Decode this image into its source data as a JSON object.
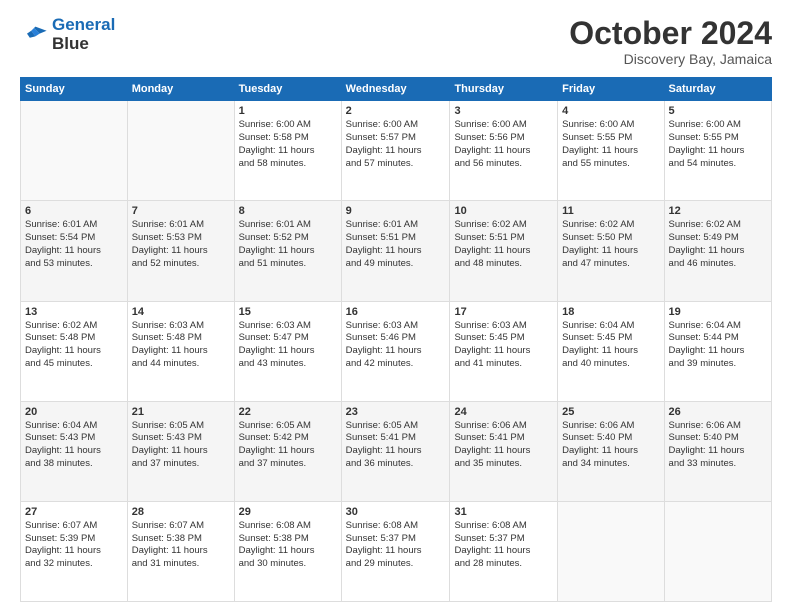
{
  "header": {
    "logo_line1": "General",
    "logo_line2": "Blue",
    "month_title": "October 2024",
    "location": "Discovery Bay, Jamaica"
  },
  "weekdays": [
    "Sunday",
    "Monday",
    "Tuesday",
    "Wednesday",
    "Thursday",
    "Friday",
    "Saturday"
  ],
  "weeks": [
    [
      {
        "day": "",
        "info": ""
      },
      {
        "day": "",
        "info": ""
      },
      {
        "day": "1",
        "info": "Sunrise: 6:00 AM\nSunset: 5:58 PM\nDaylight: 11 hours\nand 58 minutes."
      },
      {
        "day": "2",
        "info": "Sunrise: 6:00 AM\nSunset: 5:57 PM\nDaylight: 11 hours\nand 57 minutes."
      },
      {
        "day": "3",
        "info": "Sunrise: 6:00 AM\nSunset: 5:56 PM\nDaylight: 11 hours\nand 56 minutes."
      },
      {
        "day": "4",
        "info": "Sunrise: 6:00 AM\nSunset: 5:55 PM\nDaylight: 11 hours\nand 55 minutes."
      },
      {
        "day": "5",
        "info": "Sunrise: 6:00 AM\nSunset: 5:55 PM\nDaylight: 11 hours\nand 54 minutes."
      }
    ],
    [
      {
        "day": "6",
        "info": "Sunrise: 6:01 AM\nSunset: 5:54 PM\nDaylight: 11 hours\nand 53 minutes."
      },
      {
        "day": "7",
        "info": "Sunrise: 6:01 AM\nSunset: 5:53 PM\nDaylight: 11 hours\nand 52 minutes."
      },
      {
        "day": "8",
        "info": "Sunrise: 6:01 AM\nSunset: 5:52 PM\nDaylight: 11 hours\nand 51 minutes."
      },
      {
        "day": "9",
        "info": "Sunrise: 6:01 AM\nSunset: 5:51 PM\nDaylight: 11 hours\nand 49 minutes."
      },
      {
        "day": "10",
        "info": "Sunrise: 6:02 AM\nSunset: 5:51 PM\nDaylight: 11 hours\nand 48 minutes."
      },
      {
        "day": "11",
        "info": "Sunrise: 6:02 AM\nSunset: 5:50 PM\nDaylight: 11 hours\nand 47 minutes."
      },
      {
        "day": "12",
        "info": "Sunrise: 6:02 AM\nSunset: 5:49 PM\nDaylight: 11 hours\nand 46 minutes."
      }
    ],
    [
      {
        "day": "13",
        "info": "Sunrise: 6:02 AM\nSunset: 5:48 PM\nDaylight: 11 hours\nand 45 minutes."
      },
      {
        "day": "14",
        "info": "Sunrise: 6:03 AM\nSunset: 5:48 PM\nDaylight: 11 hours\nand 44 minutes."
      },
      {
        "day": "15",
        "info": "Sunrise: 6:03 AM\nSunset: 5:47 PM\nDaylight: 11 hours\nand 43 minutes."
      },
      {
        "day": "16",
        "info": "Sunrise: 6:03 AM\nSunset: 5:46 PM\nDaylight: 11 hours\nand 42 minutes."
      },
      {
        "day": "17",
        "info": "Sunrise: 6:03 AM\nSunset: 5:45 PM\nDaylight: 11 hours\nand 41 minutes."
      },
      {
        "day": "18",
        "info": "Sunrise: 6:04 AM\nSunset: 5:45 PM\nDaylight: 11 hours\nand 40 minutes."
      },
      {
        "day": "19",
        "info": "Sunrise: 6:04 AM\nSunset: 5:44 PM\nDaylight: 11 hours\nand 39 minutes."
      }
    ],
    [
      {
        "day": "20",
        "info": "Sunrise: 6:04 AM\nSunset: 5:43 PM\nDaylight: 11 hours\nand 38 minutes."
      },
      {
        "day": "21",
        "info": "Sunrise: 6:05 AM\nSunset: 5:43 PM\nDaylight: 11 hours\nand 37 minutes."
      },
      {
        "day": "22",
        "info": "Sunrise: 6:05 AM\nSunset: 5:42 PM\nDaylight: 11 hours\nand 37 minutes."
      },
      {
        "day": "23",
        "info": "Sunrise: 6:05 AM\nSunset: 5:41 PM\nDaylight: 11 hours\nand 36 minutes."
      },
      {
        "day": "24",
        "info": "Sunrise: 6:06 AM\nSunset: 5:41 PM\nDaylight: 11 hours\nand 35 minutes."
      },
      {
        "day": "25",
        "info": "Sunrise: 6:06 AM\nSunset: 5:40 PM\nDaylight: 11 hours\nand 34 minutes."
      },
      {
        "day": "26",
        "info": "Sunrise: 6:06 AM\nSunset: 5:40 PM\nDaylight: 11 hours\nand 33 minutes."
      }
    ],
    [
      {
        "day": "27",
        "info": "Sunrise: 6:07 AM\nSunset: 5:39 PM\nDaylight: 11 hours\nand 32 minutes."
      },
      {
        "day": "28",
        "info": "Sunrise: 6:07 AM\nSunset: 5:38 PM\nDaylight: 11 hours\nand 31 minutes."
      },
      {
        "day": "29",
        "info": "Sunrise: 6:08 AM\nSunset: 5:38 PM\nDaylight: 11 hours\nand 30 minutes."
      },
      {
        "day": "30",
        "info": "Sunrise: 6:08 AM\nSunset: 5:37 PM\nDaylight: 11 hours\nand 29 minutes."
      },
      {
        "day": "31",
        "info": "Sunrise: 6:08 AM\nSunset: 5:37 PM\nDaylight: 11 hours\nand 28 minutes."
      },
      {
        "day": "",
        "info": ""
      },
      {
        "day": "",
        "info": ""
      }
    ]
  ]
}
